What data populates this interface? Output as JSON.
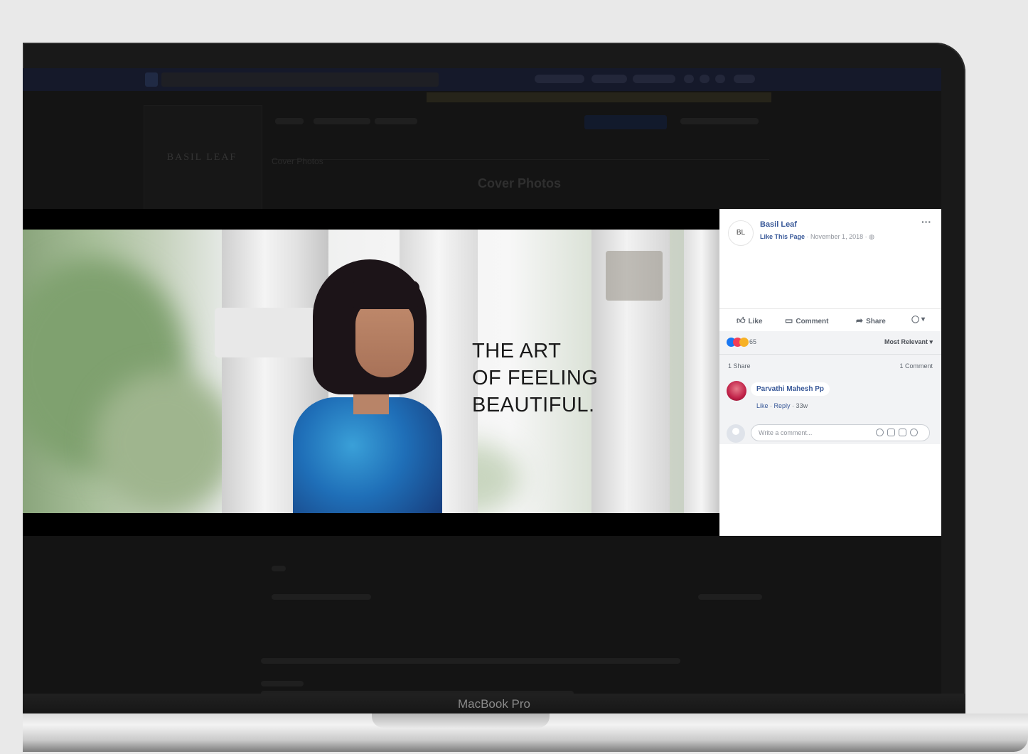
{
  "device": {
    "label": "MacBook Pro"
  },
  "background_page": {
    "brand_logo_text": "BASIL LEAF",
    "album_title": "Cover Photos",
    "section_title": "Cover Photos"
  },
  "post": {
    "page_name": "Basil Leaf",
    "avatar_text": "BL",
    "like_page_link": "Like This Page",
    "date": "· November 1, 2018 ·",
    "more_glyph": "···",
    "actions": {
      "like": "Like",
      "comment": "Comment",
      "share": "Share"
    },
    "reaction_count": "65",
    "sort_label": "Most Relevant ▾",
    "shares_label": "1 Share",
    "comments_label": "1 Comment",
    "comment": {
      "author": "Parvathi Mahesh Pp",
      "like_link": "Like",
      "reply_link": "Reply",
      "age": "· 33w"
    },
    "write_comment_placeholder": "Write a comment..."
  },
  "photo": {
    "caption_lines": [
      "THE ART",
      "OF FEELING",
      "BEAUTIFUL."
    ]
  },
  "colors": {
    "fb_link": "#385898",
    "like_blue": "#1877f2",
    "love_red": "#f33e58",
    "haha_yellow": "#f7b125"
  }
}
